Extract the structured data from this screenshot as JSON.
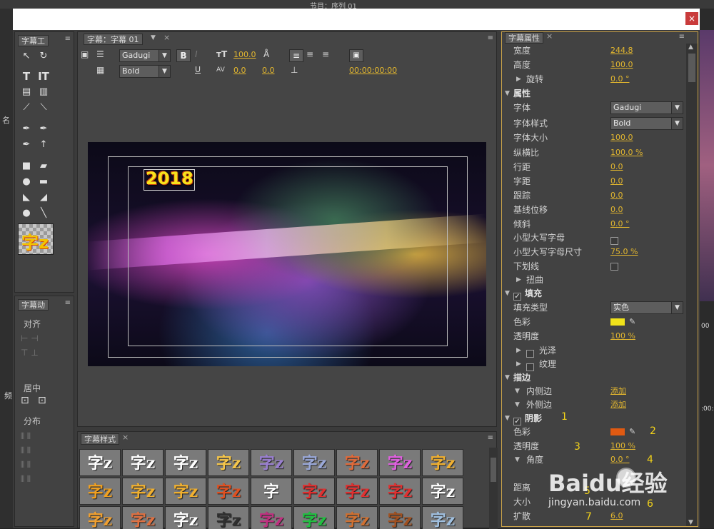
{
  "window": {
    "close_label": "×"
  },
  "tools_panel": {
    "tab": "字幕工"
  },
  "actions_panel": {
    "tab": "字幕动",
    "align_label": "对齐",
    "center_label": "居中",
    "distribute_label": "分布"
  },
  "bg_labels": {
    "left_name": "名",
    "left_frequency": "频"
  },
  "sample_thumb": {
    "text": "字z"
  },
  "editor": {
    "tab": "字幕：字幕 01",
    "font_name": "Gadugi",
    "font_style": "Bold",
    "font_size": "100.0",
    "kerning": "0.0",
    "leading": "0.0",
    "timecode": "00:00:00:00",
    "title_text": "2018"
  },
  "styles_panel": {
    "tab": "字幕样式",
    "cells": [
      "字z",
      "字z",
      "字z",
      "字z",
      "字z",
      "字z",
      "字z",
      "字z",
      "字z",
      "字z",
      "字z",
      "字z",
      "字z",
      "字",
      "字z",
      "字z",
      "字z",
      "字z",
      "字z",
      "字z",
      "字z",
      "字z",
      "字z",
      "字z",
      "字z",
      "字z",
      "字z"
    ],
    "cell_colors": [
      "#ffffff",
      "#ffffff",
      "#ffffff",
      "#f6c64a",
      "#9a7fd0",
      "#9aa8d8",
      "#e06a3a",
      "#e060e0",
      "#f0b030",
      "#f0a020",
      "#f0b030",
      "#f0b030",
      "#e05020",
      "#ffffff",
      "#e03030",
      "#e03030",
      "#e03030",
      "#ffffff",
      "#f0a030",
      "#e07040",
      "#ffffff",
      "#303030",
      "#c03080",
      "#20c040",
      "#d07030",
      "#a05020",
      "#a0c0e0"
    ]
  },
  "props": {
    "tab": "字幕属性",
    "width_label": "宽度",
    "width_value": "244.8",
    "height_label": "高度",
    "height_value": "100.0",
    "rotation_label": "旋转",
    "rotation_value": "0.0 °",
    "attributes_label": "属性",
    "font_label": "字体",
    "font_value": "Gadugi",
    "font_style_label": "字体样式",
    "font_style_value": "Bold",
    "font_size_label": "字体大小",
    "font_size_value": "100.0",
    "aspect_label": "纵横比",
    "aspect_value": "100.0 %",
    "leading_label": "行距",
    "leading_value": "0.0",
    "kerning_label": "字距",
    "kerning_value": "0.0",
    "tracking_label": "跟踪",
    "tracking_value": "0.0",
    "baseline_label": "基线位移",
    "baseline_value": "0.0",
    "slant_label": "倾斜",
    "slant_value": "0.0 °",
    "smallcaps_label": "小型大写字母",
    "smallcaps_size_label": "小型大写字母尺寸",
    "smallcaps_size_value": "75.0 %",
    "underline_label": "下划线",
    "distort_label": "扭曲",
    "fill_label": "填充",
    "fill_type_label": "填充类型",
    "fill_type_value": "实色",
    "fill_color_label": "色彩",
    "fill_color": "#f0e21a",
    "fill_opacity_label": "透明度",
    "fill_opacity_value": "100 %",
    "sheen_label": "光泽",
    "texture_label": "纹理",
    "strokes_label": "描边",
    "inner_stroke_label": "内侧边",
    "inner_stroke_add": "添加",
    "outer_stroke_label": "外侧边",
    "outer_stroke_add": "添加",
    "shadow_label": "阴影",
    "shadow_color_label": "色彩",
    "shadow_color": "#e05a12",
    "shadow_opacity_label": "透明度",
    "shadow_opacity_value": "100 %",
    "angle_label": "角度",
    "angle_value": "0.0 °",
    "distance_label": "距离",
    "size_label": "大小",
    "spread_label": "扩散",
    "spread_value": "6.0"
  },
  "annotations": [
    "1",
    "2",
    "3",
    "4",
    "5",
    "6",
    "7"
  ],
  "watermark": {
    "brand": "Baidu经验",
    "url": "jingyan.baidu.com"
  },
  "bg_window": {
    "tab_text": "节目：序列 01",
    "timecode": ":00:2",
    "tick": "00"
  }
}
